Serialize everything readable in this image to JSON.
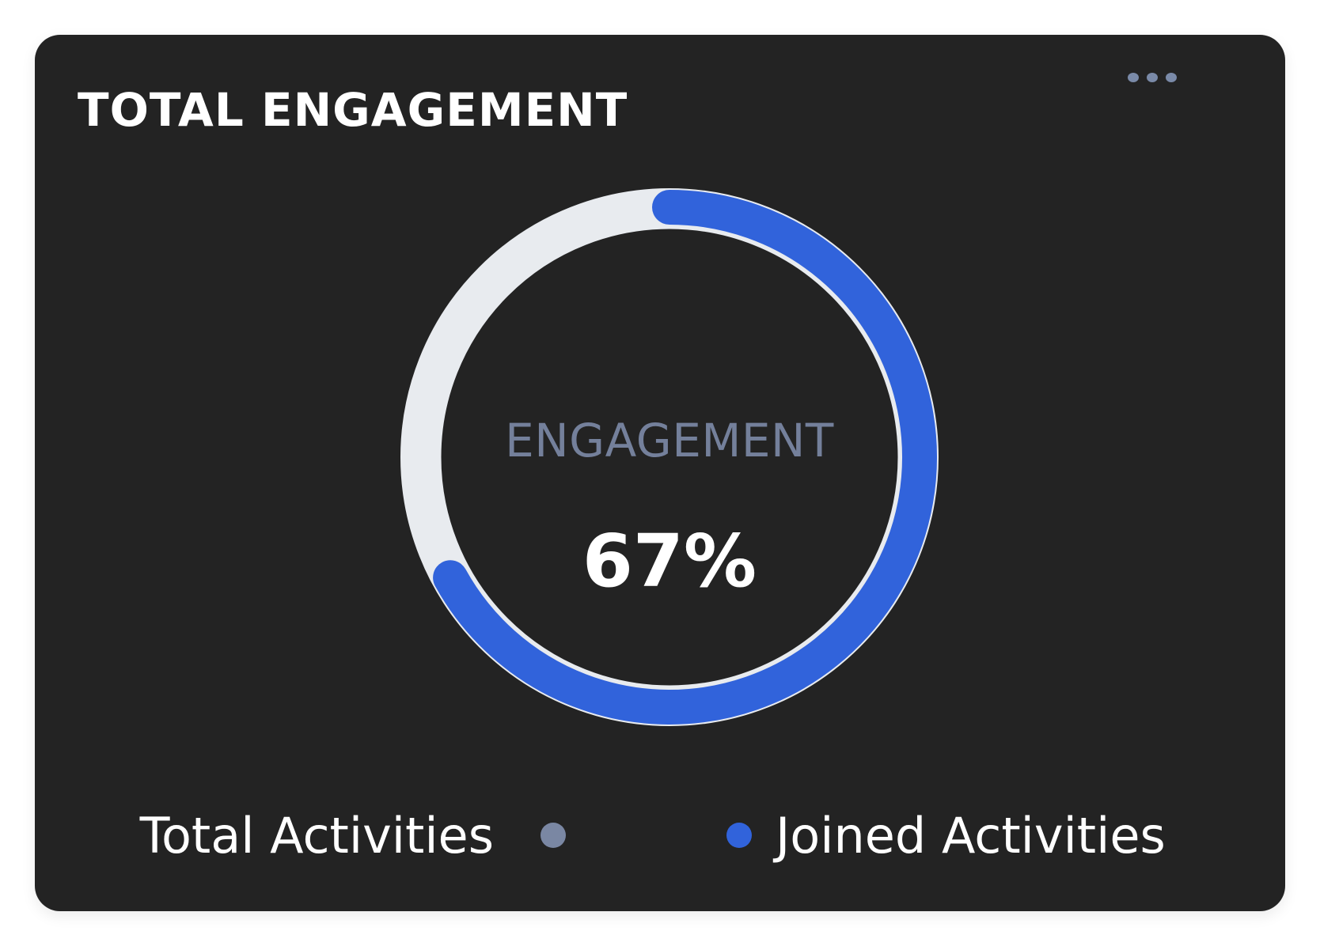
{
  "card": {
    "title": "TOTAL ENGAGEMENT",
    "more_icon": "more-horizontal-icon"
  },
  "chart_data": {
    "type": "pie",
    "variant": "donut",
    "center_label": "ENGAGEMENT",
    "center_value": "67%",
    "progress": 0.67,
    "series": [
      {
        "name": "Total Activities",
        "color": "#7a87a3",
        "track_color": "#e8ebef"
      },
      {
        "name": "Joined Activities",
        "color": "#3163db"
      }
    ],
    "legend": [
      "Total Activities",
      "Joined Activities"
    ],
    "legend_placement": "bottom"
  }
}
